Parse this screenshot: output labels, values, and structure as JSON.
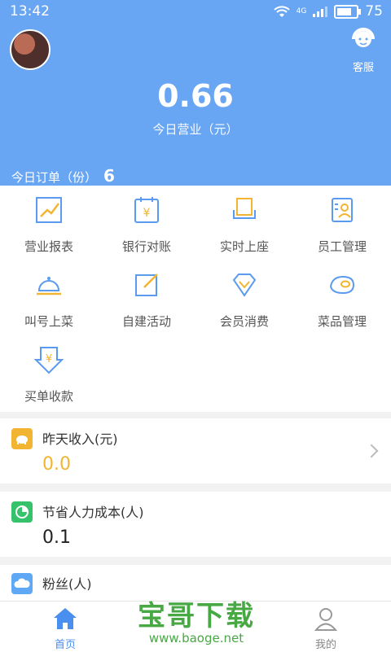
{
  "status_bar": {
    "time": "13:42",
    "network": "4G",
    "battery": "75",
    "battery_level_percent": 75
  },
  "header": {
    "service_label": "客服",
    "today_revenue_value": "0.66",
    "today_revenue_label": "今日营业（元）",
    "today_orders_label": "今日订单（份）",
    "today_orders_count": "6"
  },
  "menu": {
    "items": [
      {
        "label": "营业报表",
        "icon": "report-chart-icon"
      },
      {
        "label": "银行对账",
        "icon": "bank-calendar-icon"
      },
      {
        "label": "实时上座",
        "icon": "seat-icon"
      },
      {
        "label": "员工管理",
        "icon": "staff-icon"
      },
      {
        "label": "叫号上菜",
        "icon": "bell-icon"
      },
      {
        "label": "自建活动",
        "icon": "edit-icon"
      },
      {
        "label": "会员消费",
        "icon": "diamond-icon"
      },
      {
        "label": "菜品管理",
        "icon": "dish-icon"
      },
      {
        "label": "买单收款",
        "icon": "payment-icon"
      }
    ]
  },
  "cards": {
    "yesterday": {
      "title": "昨天收入(元)",
      "value": "0.0",
      "color": "#f2b531"
    },
    "labor": {
      "title": "节省人力成本(人)",
      "value": "0.1",
      "color": "#35c26a"
    },
    "fans": {
      "title": "粉丝(人)",
      "color": "#5fa8f6"
    }
  },
  "bottom_nav": {
    "home_label": "首页",
    "mine_label": "我的",
    "active_color": "#4a8ff0"
  },
  "watermark": {
    "brand": "宝哥下载",
    "url": "www.baoge.net"
  },
  "colors": {
    "primary": "#68a6f3",
    "icon_blue": "#5a9bf0",
    "icon_yellow": "#f2b531"
  }
}
